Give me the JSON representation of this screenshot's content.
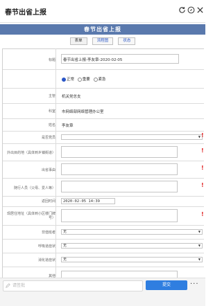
{
  "app": {
    "title": "春节出省上报"
  },
  "banner": {
    "title": "春节出省上报"
  },
  "tabs": [
    {
      "label": "表单"
    },
    {
      "label": "流程图"
    },
    {
      "label": "状态"
    }
  ],
  "form": {
    "title_label": "标题",
    "title_value": "春节出省上报-李友章-2020-02-05",
    "priority_options": [
      "正常",
      "重要",
      "紧急"
    ],
    "priority_selected": "正常",
    "dept_label": "主管",
    "dept_value": "机关党总支",
    "office_label": "科室",
    "office_value": "市网络部网络管理办公室",
    "name_label": "姓名",
    "name_value": "李友章",
    "party_label": "是否党员",
    "out_dest_label": "外出目的地（具体到乡镇街道）",
    "reason_label": "出省事由",
    "companion_label": "随行人员（父母、爱人等）",
    "start_label": "返回时间",
    "start_value": "2020-02-05 14:39",
    "address_label": "现居住地址（具体到小区楼门牌号）",
    "contact_label": "非值班者",
    "contact_value": "无",
    "heat_label": "呼吸道症状",
    "heat_value": "无",
    "touch_label": "消化道症状",
    "touch_value": "无",
    "other_label": "其他"
  },
  "bottom": {
    "comment_placeholder": "请签批",
    "submit_label": "提交",
    "more_label": "···"
  },
  "icons": [
    "refresh-icon",
    "compass-icon",
    "close-icon",
    "edit-icon"
  ],
  "colors": {
    "banner": "#5a79ad",
    "submit": "#2f7ee0",
    "required": "#e02424"
  }
}
